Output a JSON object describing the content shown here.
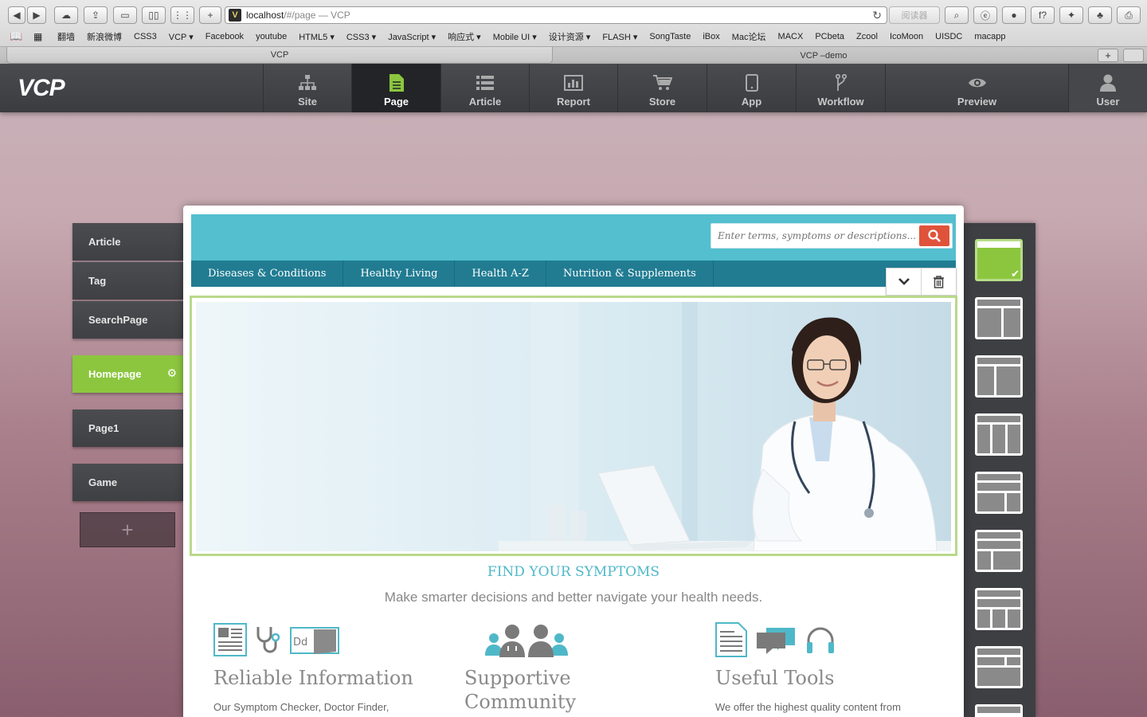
{
  "browser": {
    "url_host": "localhost",
    "url_rest": "/#/page — VCP",
    "reader_label": "阅读器",
    "bookmarks": [
      "翻墙",
      "新浪微博",
      "CSS3",
      "VCP ▾",
      "Facebook",
      "youtube",
      "HTML5 ▾",
      "CSS3 ▾",
      "JavaScript ▾",
      "响应式 ▾",
      "Mobile UI ▾",
      "设计资源 ▾",
      "FLASH ▾",
      "SongTaste",
      "iBox",
      "Mac论坛",
      "MACX",
      "PCbeta",
      "Zcool",
      "IcoMoon",
      "UISDC",
      "macapp"
    ],
    "tabs": [
      "VCP",
      "VCP –demo"
    ]
  },
  "app": {
    "logo": "VCP",
    "nav": [
      {
        "label": "Site",
        "icon": "sitemap-icon"
      },
      {
        "label": "Page",
        "icon": "page-icon"
      },
      {
        "label": "Article",
        "icon": "list-icon"
      },
      {
        "label": "Report",
        "icon": "chart-icon"
      },
      {
        "label": "Store",
        "icon": "cart-icon"
      },
      {
        "label": "App",
        "icon": "tablet-icon"
      },
      {
        "label": "Workflow",
        "icon": "branch-icon"
      },
      {
        "label": "Preview",
        "icon": "eye-icon"
      },
      {
        "label": "User",
        "icon": "user-icon"
      }
    ],
    "active_nav": "Page",
    "accent": "#8cc63f"
  },
  "pages": [
    "Article",
    "Tag",
    "SearchPage",
    "Homepage",
    "Page1",
    "Game"
  ],
  "active_page": "Homepage",
  "add_page_label": "+",
  "site": {
    "search_placeholder": "Enter terms, symptoms or descriptions...",
    "nav": [
      "Diseases & Conditions",
      "Healthy Living",
      "Health A-Z",
      "Nutrition & Supplements"
    ],
    "heading": "FIND YOUR SYMPTOMS",
    "subheading": "Make smarter decisions and better navigate your health needs.",
    "features": [
      {
        "title": "Reliable Information",
        "text": "Our Symptom Checker, Doctor Finder,"
      },
      {
        "title": "Supportive Community",
        "text": ""
      },
      {
        "title": "Useful Tools",
        "text": "We offer the highest quality content from"
      }
    ],
    "header_color": "#54bfcf",
    "nav_color": "#217c92",
    "search_button_color": "#e0533a"
  }
}
